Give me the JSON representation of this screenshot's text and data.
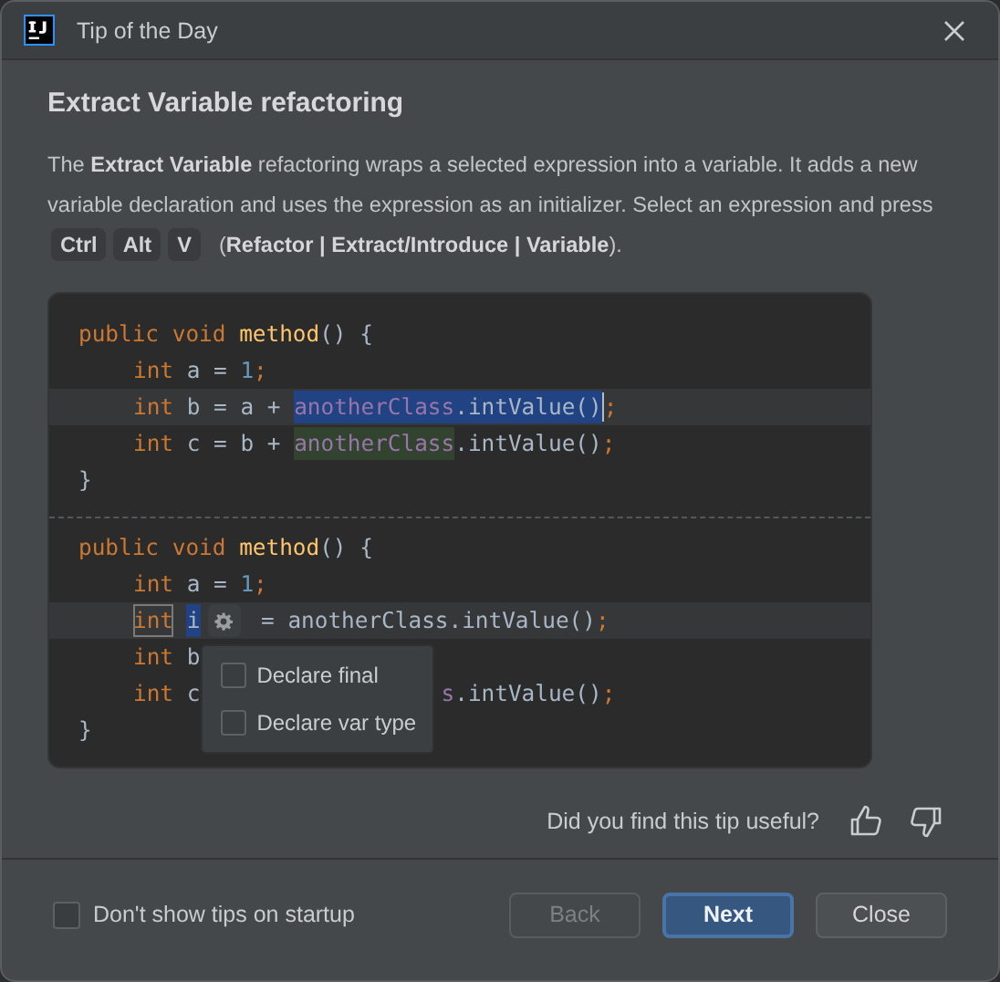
{
  "window": {
    "title": "Tip of the Day"
  },
  "tip": {
    "title": "Extract Variable refactoring",
    "text": "The **Extract Variable** refactoring wraps a selected expression into a variable. It adds a new variable declaration and uses the expression as an initializer. Select an expression and press",
    "shortcut": [
      "Ctrl",
      "Alt",
      "V"
    ],
    "menu_path": "(**Refactor | Extract/Introduce | Variable**)."
  },
  "code_before": {
    "lines": [
      {
        "current": false,
        "tokens": [
          {
            "t": "public void ",
            "kind": "keyword"
          },
          {
            "t": "method",
            "kind": "method"
          },
          {
            "t": "() {",
            "kind": "plain"
          }
        ],
        "children": [
          {
            "current": false,
            "tokens": [
              {
                "t": "int",
                "kind": "keyword"
              },
              {
                "t": " a = ",
                "kind": "plain"
              },
              {
                "t": "1",
                "kind": "number"
              },
              {
                "t": ";",
                "kind": "punct"
              }
            ]
          },
          {
            "current": true,
            "tokens": [
              {
                "t": "int",
                "kind": "keyword"
              },
              {
                "t": " b = a + ",
                "kind": "plain"
              },
              {
                "kind": "selection",
                "tokens": [
                  {
                    "t": "anotherClass",
                    "kind": "field"
                  },
                  {
                    "t": ".intValue()",
                    "kind": "plain"
                  }
                ]
              },
              {
                "kind": "caret"
              },
              {
                "t": ";",
                "kind": "punct"
              }
            ]
          },
          {
            "current": false,
            "tokens": [
              {
                "t": "int",
                "kind": "keyword"
              },
              {
                "t": " c = b + ",
                "kind": "plain"
              },
              {
                "kind": "usage",
                "tokens": [
                  {
                    "t": "anotherClass",
                    "kind": "field"
                  }
                ]
              },
              {
                "t": ".intValue()",
                "kind": "plain"
              },
              {
                "t": ";",
                "kind": "punct"
              }
            ]
          }
        ]
      },
      {
        "current": false,
        "tokens": [
          {
            "t": "}",
            "kind": "plain"
          }
        ]
      }
    ]
  },
  "code_after": {
    "lines": [
      {
        "current": false,
        "tokens": [
          {
            "t": "public void ",
            "kind": "keyword"
          },
          {
            "t": "method",
            "kind": "method"
          },
          {
            "t": "() {",
            "kind": "plain"
          }
        ],
        "children": [
          {
            "current": false,
            "tokens": [
              {
                "t": "int",
                "kind": "keyword"
              },
              {
                "t": " a = ",
                "kind": "plain"
              },
              {
                "t": "1",
                "kind": "number"
              },
              {
                "t": ";",
                "kind": "punct"
              }
            ]
          },
          {
            "current": true,
            "tokens": [
              {
                "kind": "template",
                "tokens": [
                  {
                    "t": "int",
                    "kind": "keyword"
                  }
                ]
              },
              {
                "kind": "selection",
                "tokens": [
                  {
                    "t": "i",
                    "kind": "plain"
                  }
                ]
              },
              {
                "kind": "gear"
              },
              {
                "t": " = anotherClass.intValue()",
                "kind": "plain"
              },
              {
                "t": ";",
                "kind": "punct"
              }
            ]
          },
          {
            "current": false,
            "tokens": [
              {
                "t": "int",
                "kind": "keyword"
              },
              {
                "t": " b",
                "kind": "plain"
              }
            ]
          },
          {
            "current": false,
            "tokens": [
              {
                "t": "int",
                "kind": "keyword"
              },
              {
                "t": " c",
                "kind": "plain"
              },
              {
                "kind": "covered"
              },
              {
                "t": "s",
                "kind": "field"
              },
              {
                "t": ".intValue()",
                "kind": "plain"
              },
              {
                "t": ";",
                "kind": "punct"
              }
            ]
          }
        ]
      },
      {
        "current": false,
        "tokens": [
          {
            "t": "}",
            "kind": "plain"
          }
        ]
      }
    ],
    "popup": {
      "options": [
        {
          "label": "Declare final",
          "checked": false
        },
        {
          "label": "Declare var type",
          "checked": false
        }
      ]
    }
  },
  "feedback": {
    "question": "Did you find this tip useful?"
  },
  "dont_show": {
    "label": "Don't show tips on startup",
    "checked": false
  },
  "buttons": [
    {
      "label": "Back",
      "kind": "secondary",
      "disabled": true
    },
    {
      "label": "Next",
      "kind": "default",
      "disabled": false
    },
    {
      "label": "Close",
      "kind": "secondary",
      "disabled": false
    }
  ]
}
